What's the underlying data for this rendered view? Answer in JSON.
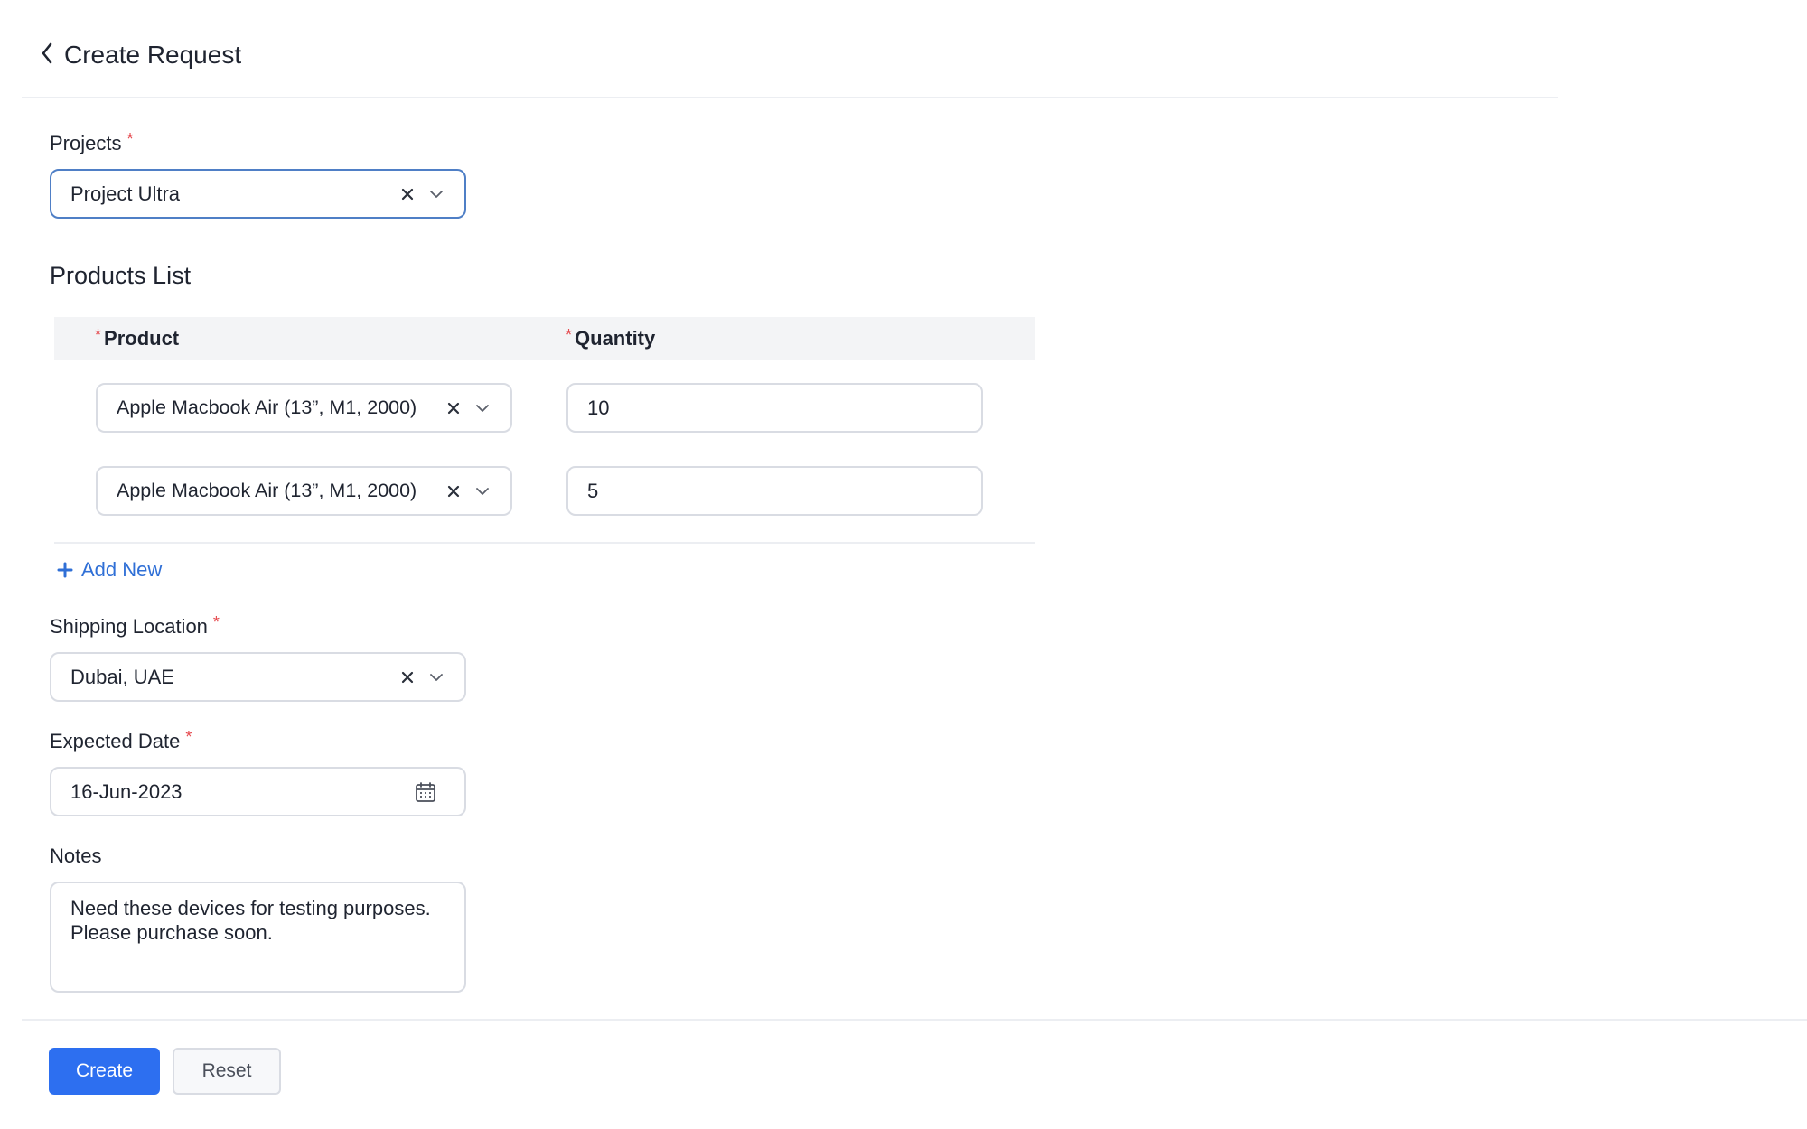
{
  "header": {
    "title": "Create Request",
    "back_icon": "chevron-left-icon"
  },
  "projects": {
    "label": "Projects",
    "required_mark": "*",
    "value": "Project Ultra"
  },
  "products": {
    "section_title": "Products List",
    "columns": [
      {
        "label": "Product",
        "required_mark": "*"
      },
      {
        "label": "Quantity",
        "required_mark": "*"
      }
    ],
    "rows": [
      {
        "product": "Apple Macbook Air (13”, M1, 2000)",
        "quantity": "10"
      },
      {
        "product": "Apple Macbook Air (13”, M1, 2000)",
        "quantity": "5"
      }
    ],
    "add_new_label": "Add New"
  },
  "shipping": {
    "label": "Shipping Location",
    "required_mark": "*",
    "value": "Dubai, UAE"
  },
  "expected_date": {
    "label": "Expected Date",
    "required_mark": "*",
    "value": "16-Jun-2023"
  },
  "notes": {
    "label": "Notes",
    "value": "Need these devices for testing purposes.\nPlease purchase soon."
  },
  "actions": {
    "create_label": "Create",
    "reset_label": "Reset"
  },
  "colors": {
    "accent": "#2d6ff0",
    "link": "#2f6fd6",
    "required": "#e5484d",
    "focus_border": "#4f7fc6"
  }
}
